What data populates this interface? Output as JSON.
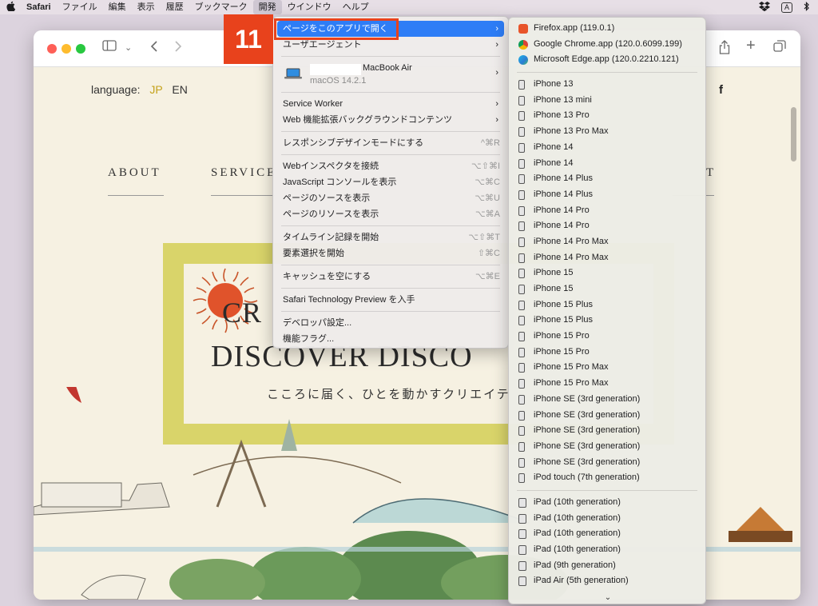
{
  "menubar": {
    "apple": "",
    "items": [
      "Safari",
      "ファイル",
      "編集",
      "表示",
      "履歴",
      "ブックマーク",
      "開発",
      "ウインドウ",
      "ヘルプ"
    ],
    "active_index": 6,
    "right": {
      "keyboard": "A",
      "bluetooth": "✱",
      "control": "⌘"
    }
  },
  "annotation": {
    "step": "11"
  },
  "page": {
    "language_label": "language:",
    "lang_jp": "JP",
    "lang_en": "EN",
    "nav": [
      "ABOUT",
      "SERVICE",
      "T"
    ],
    "facebook": "f",
    "hero_line1": "CR",
    "hero_line2": "DISCOVER DISCO",
    "hero_line3": "こころに届く、ひとを動かすクリエイテ"
  },
  "develop_menu": {
    "items": [
      {
        "label": "ページをこのアプリで開く",
        "submenu": true,
        "highlight": true
      },
      {
        "label": "ユーザエージェント",
        "submenu": true
      }
    ],
    "device": {
      "name": "MacBook Air",
      "os": "macOS 14.2.1"
    },
    "group2": [
      {
        "label": "Service Worker",
        "submenu": true
      },
      {
        "label": "Web 機能拡張バックグラウンドコンテンツ",
        "submenu": true
      }
    ],
    "group3": [
      {
        "label": "レスポンシブデザインモードにする",
        "shortcut": "^⌘R"
      }
    ],
    "group4": [
      {
        "label": "Webインスペクタを接続",
        "shortcut": "⌥⇧⌘I"
      },
      {
        "label": "JavaScript コンソールを表示",
        "shortcut": "⌥⌘C"
      },
      {
        "label": "ページのソースを表示",
        "shortcut": "⌥⌘U"
      },
      {
        "label": "ページのリソースを表示",
        "shortcut": "⌥⌘A"
      }
    ],
    "group5": [
      {
        "label": "タイムライン記録を開始",
        "shortcut": "⌥⇧⌘T"
      },
      {
        "label": "要素選択を開始",
        "shortcut": "⇧⌘C"
      }
    ],
    "group6": [
      {
        "label": "キャッシュを空にする",
        "shortcut": "⌥⌘E"
      }
    ],
    "group7": [
      {
        "label": "Safari Technology Preview を入手"
      }
    ],
    "group8": [
      {
        "label": "デベロッパ設定..."
      },
      {
        "label": "機能フラグ..."
      }
    ]
  },
  "open_with_submenu": {
    "browsers": [
      {
        "label": "Firefox.app (119.0.1)",
        "icon": "firefox-icon"
      },
      {
        "label": "Google Chrome.app (120.0.6099.199)",
        "icon": "chrome-icon"
      },
      {
        "label": "Microsoft Edge.app (120.0.2210.121)",
        "icon": "edge-icon"
      }
    ],
    "iphones": [
      "iPhone 13",
      "iPhone 13 mini",
      "iPhone 13 Pro",
      "iPhone 13 Pro Max",
      "iPhone 14",
      "iPhone 14",
      "iPhone 14 Plus",
      "iPhone 14 Plus",
      "iPhone 14 Pro",
      "iPhone 14 Pro",
      "iPhone 14 Pro Max",
      "iPhone 14 Pro Max",
      "iPhone 15",
      "iPhone 15",
      "iPhone 15 Plus",
      "iPhone 15 Plus",
      "iPhone 15 Pro",
      "iPhone 15 Pro",
      "iPhone 15 Pro Max",
      "iPhone 15 Pro Max",
      "iPhone SE (3rd generation)",
      "iPhone SE (3rd generation)",
      "iPhone SE (3rd generation)",
      "iPhone SE (3rd generation)",
      "iPhone SE (3rd generation)",
      "iPod touch (7th generation)"
    ],
    "ipads": [
      "iPad (10th generation)",
      "iPad (10th generation)",
      "iPad (10th generation)",
      "iPad (10th generation)",
      "iPad (9th generation)",
      "iPad Air (5th generation)"
    ],
    "more": "⌄"
  }
}
